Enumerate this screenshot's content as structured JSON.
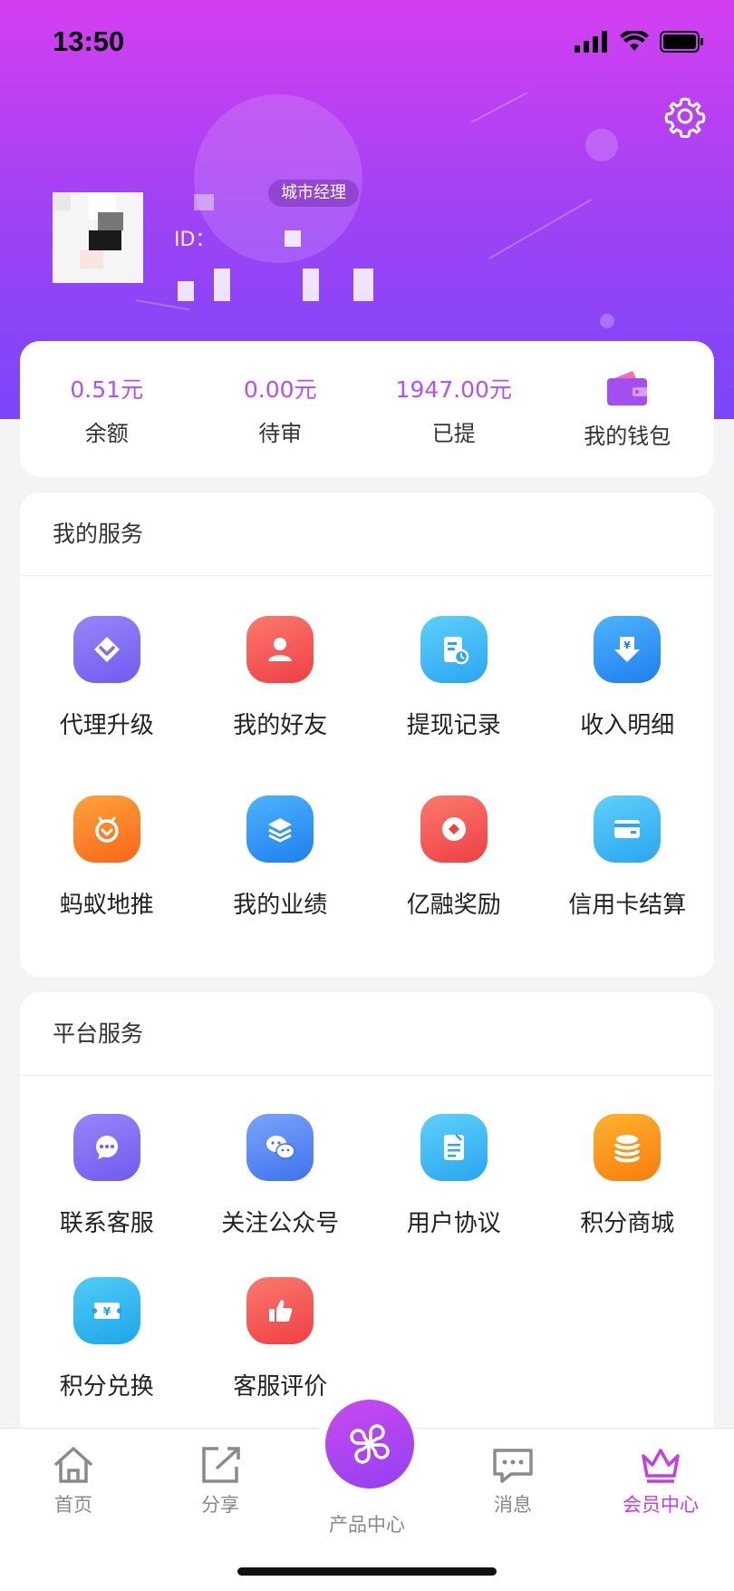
{
  "status": {
    "time": "13:50"
  },
  "profile": {
    "role_badge": "城市经理",
    "id_label": "ID："
  },
  "wallet": {
    "items": [
      {
        "value": "0.51元",
        "label": "余额"
      },
      {
        "value": "0.00元",
        "label": "待审"
      },
      {
        "value": "1947.00元",
        "label": "已提"
      }
    ],
    "my_wallet_label": "我的钱包"
  },
  "my_services": {
    "title": "我的服务",
    "items": [
      {
        "label": "代理升级",
        "icon": "diamond-icon",
        "color": "#7b6ff2"
      },
      {
        "label": "我的好友",
        "icon": "user-icon",
        "color": "#f2544f"
      },
      {
        "label": "提现记录",
        "icon": "record-icon",
        "color": "#3fb8f5"
      },
      {
        "label": "收入明细",
        "icon": "yen-download-icon",
        "color": "#2e8ff2"
      },
      {
        "label": "蚂蚁地推",
        "icon": "ant-icon",
        "color": "#fb7a1f"
      },
      {
        "label": "我的业绩",
        "icon": "layers-icon",
        "color": "#2e8ff2"
      },
      {
        "label": "亿融奖励",
        "icon": "reward-icon",
        "color": "#f2544f"
      },
      {
        "label": "信用卡结算",
        "icon": "credit-card-icon",
        "color": "#33b7f2"
      }
    ]
  },
  "platform_services": {
    "title": "平台服务",
    "items": [
      {
        "label": "联系客服",
        "icon": "chat-icon",
        "color": "#7b6ff2"
      },
      {
        "label": "关注公众号",
        "icon": "wechat-icon",
        "color": "#5a8af2"
      },
      {
        "label": "用户协议",
        "icon": "agreement-icon",
        "color": "#3fb8f5"
      },
      {
        "label": "积分商城",
        "icon": "coins-icon",
        "color": "#fb8d14"
      },
      {
        "label": "积分兑换",
        "icon": "exchange-icon",
        "color": "#2ab4ee"
      },
      {
        "label": "客服评价",
        "icon": "thumbs-up-icon",
        "color": "#f2544f"
      }
    ]
  },
  "tabbar": {
    "home": "首页",
    "share": "分享",
    "products": "产品中心",
    "messages": "消息",
    "member": "会员中心",
    "active_color": "#c23ee8"
  }
}
